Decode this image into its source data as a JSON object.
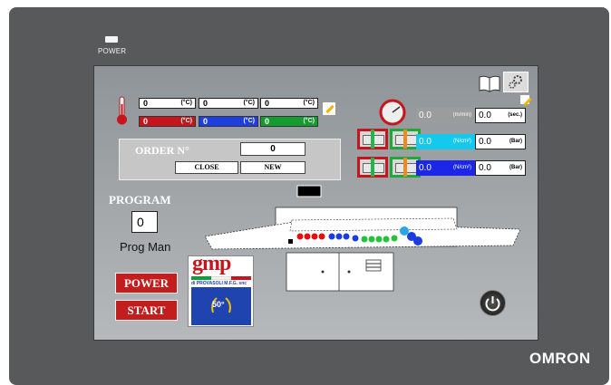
{
  "device": {
    "power_label": "POWER",
    "brand": "OMRON"
  },
  "temps": {
    "unit": "(°C)",
    "set": [
      "0",
      "0",
      "0"
    ],
    "actual": [
      "0",
      "0",
      "0"
    ],
    "colors": [
      "#c4161c",
      "#1e3fe0",
      "#149c2e"
    ]
  },
  "order": {
    "label": "ORDER N°",
    "value": "0",
    "close_label": "CLOSE",
    "new_label": "NEW"
  },
  "program": {
    "label": "PROGRAM",
    "value": "0",
    "mode": "Prog Man"
  },
  "controls": {
    "power_label": "POWER",
    "start_label": "START"
  },
  "logo": {
    "name": "gmp",
    "tagline": "di PROVASOLI M.F.G. snc",
    "anniversary": "50°"
  },
  "gauges": [
    {
      "value": "0.0",
      "unit": "(m/min)",
      "color": "#9a9c9e",
      "set_value": "0.0",
      "set_unit": "(sec.)"
    },
    {
      "value": "0.0",
      "unit": "(N/cm²)",
      "color": "#15c8ee",
      "set_value": "0.0",
      "set_unit": "(Bar)"
    },
    {
      "value": "0.0",
      "unit": "(N/cm²)",
      "color": "#1b26e6",
      "set_value": "0.0",
      "set_unit": "(Bar)"
    }
  ],
  "icons": {
    "thermometer": "thermometer-icon",
    "edit": "edit-icon",
    "book": "book-icon",
    "settings": "settings-icon",
    "gauge": "pressure-gauge-icon",
    "power": "power-icon"
  }
}
